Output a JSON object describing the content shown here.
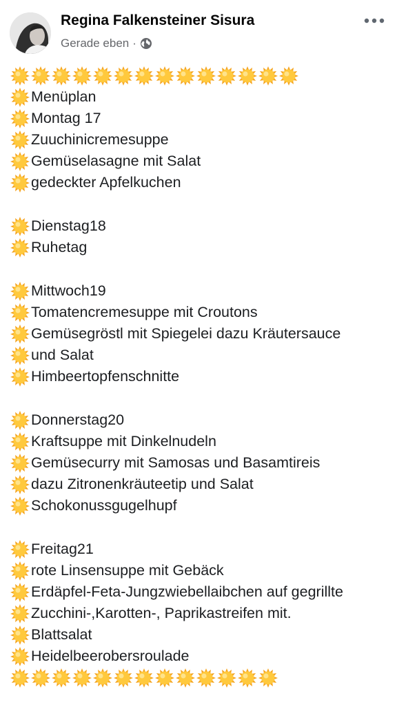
{
  "post": {
    "author": "Regina Falkensteiner Sisura",
    "time": "Gerade eben",
    "separator": "·",
    "privacy_icon": "globe-icon",
    "more_icon": "more-dots-icon",
    "decoration_icon": "sun-emoji-icon",
    "top_sun_count": 14,
    "bottom_sun_count": 13,
    "blocks": [
      [
        "Menüplan",
        "Montag 17",
        "Zuuchinicremesuppe",
        "Gemüselasagne mit Salat",
        "gedeckter Apfelkuchen"
      ],
      [
        "Dienstag18",
        "Ruhetag"
      ],
      [
        "Mittwoch19",
        "Tomatencremesuppe mit Croutons",
        "Gemüsegröstl mit Spiegelei dazu Kräutersauce",
        "und Salat",
        "Himbeertopfenschnitte"
      ],
      [
        "Donnerstag20",
        "Kraftsuppe mit Dinkelnudeln",
        "Gemüsecurry mit Samosas und Basamtireis",
        "dazu Zitronenkräuteetip und Salat",
        "Schokonussgugelhupf"
      ],
      [
        "Freitag21",
        "rote Linsensuppe mit Gebäck",
        "Erdäpfel-Feta-Jungzwiebellaibchen auf gegrillte",
        "Zucchini-,Karotten-, Paprikastreifen mit.",
        "Blattsalat",
        "Heidelbeerobersroulade"
      ]
    ]
  },
  "colors": {
    "sun_fill": "#FFC93D",
    "sun_ray": "#F5A623",
    "meta_gray": "#65676B"
  }
}
